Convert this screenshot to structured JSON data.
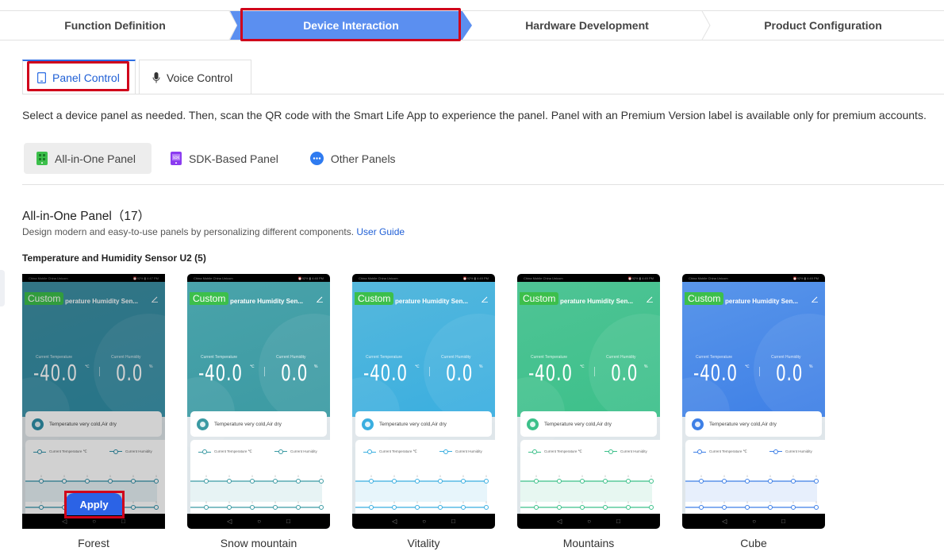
{
  "steps": [
    {
      "label": "Function Definition",
      "active": false
    },
    {
      "label": "Device Interaction",
      "active": true
    },
    {
      "label": "Hardware Development",
      "active": false
    },
    {
      "label": "Product Configuration",
      "active": false
    }
  ],
  "tabs": [
    {
      "label": "Panel Control",
      "icon": "tablet-icon",
      "active": true
    },
    {
      "label": "Voice Control",
      "icon": "microphone-icon",
      "active": false
    }
  ],
  "description": "Select a device panel as needed. Then, scan the QR code with the Smart Life App to experience the panel. Panel with an Premium Version label is available only for premium accounts.",
  "filters": [
    {
      "label": "All-in-One Panel",
      "icon": "grid-panel-icon",
      "color": "#3cbf4b",
      "active": true
    },
    {
      "label": "SDK-Based Panel",
      "icon": "sdk-panel-icon",
      "color": "#8b3cf0",
      "active": false
    },
    {
      "label": "Other Panels",
      "icon": "more-dots-icon",
      "color": "#2f7bf0",
      "active": false
    }
  ],
  "section": {
    "title": "All-in-One Panel（17）",
    "desc": "Design modern and easy-to-use panels by personalizing different components.",
    "link": "User Guide",
    "group_title": "Temperature and Humidity Sensor U2 (5)"
  },
  "preview": {
    "badge": "Custom",
    "title": "perature Humidity Sen...",
    "temp_label": "Current Temperature",
    "hum_label": "Current Humidity",
    "temp_value": "-40.0",
    "temp_unit": "℃",
    "hum_value": "0.0",
    "hum_unit": "%",
    "message": "Temperature very cold,Air dry",
    "legend_temp": "Current Temperature ℃",
    "legend_hum": "Current Humidity",
    "status_left": "China Mobile China Unicom",
    "apply_label": "Apply"
  },
  "cards": [
    {
      "name": "Forest",
      "time": "4:47 PM",
      "battery": "92%",
      "color": "#3f8fa3",
      "accent": "#2f8fa8",
      "selected": true
    },
    {
      "name": "Snow mountain",
      "time": "4:48 PM",
      "battery": "92%",
      "color": "#4aa3aa",
      "accent": "#3b9aa3",
      "selected": false
    },
    {
      "name": "Vitality",
      "time": "4:49 PM",
      "battery": "92%",
      "color": "#56b8dc",
      "accent": "#39aee0",
      "selected": false
    },
    {
      "name": "Mountains",
      "time": "4:49 PM",
      "battery": "92%",
      "color": "#4fc495",
      "accent": "#3cc08a",
      "selected": false
    },
    {
      "name": "Cube",
      "time": "4:49 PM",
      "battery": "92%",
      "color": "#5a96ea",
      "accent": "#3d7fe6",
      "selected": false
    }
  ]
}
